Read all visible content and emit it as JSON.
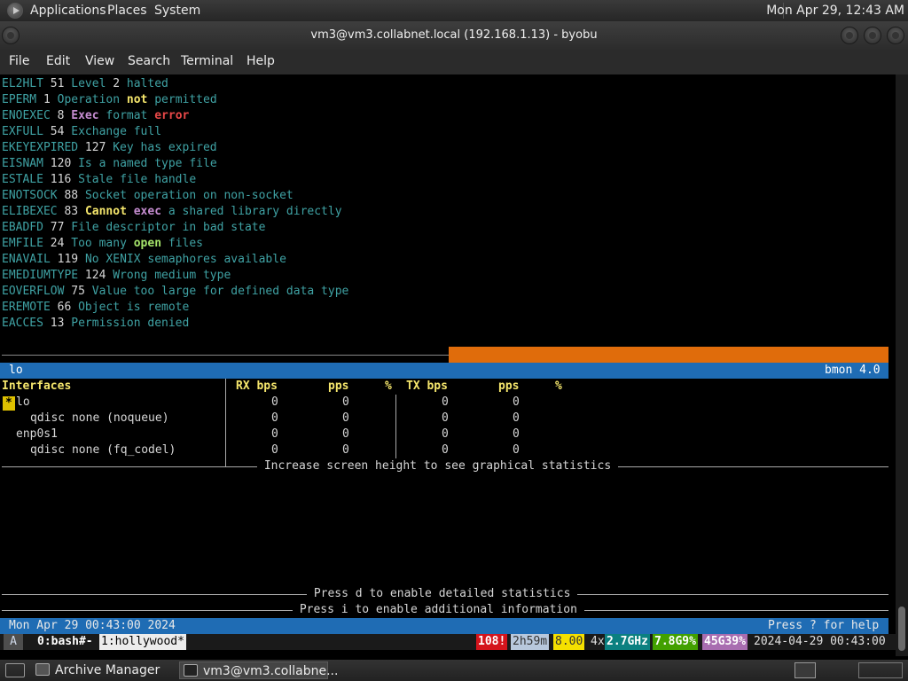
{
  "top_panel": {
    "applications": "Applications",
    "places": "Places",
    "system": "System",
    "clock": "Mon Apr 29, 12:43 AM"
  },
  "window": {
    "title": "vm3@vm3.collabnet.local (192.168.1.13) - byobu"
  },
  "menubar": [
    "File",
    "Edit",
    "View",
    "Search",
    "Terminal",
    "Help"
  ],
  "errors": [
    {
      "name": "EL2HLT",
      "num": "51",
      "parts": [
        [
          "Level ",
          "d"
        ],
        [
          "2",
          "n"
        ],
        [
          " halted",
          "d"
        ]
      ]
    },
    {
      "name": "EPERM",
      "num": "1",
      "parts": [
        [
          "Operation ",
          "d"
        ],
        [
          "not",
          "y"
        ],
        [
          " permitted",
          "d"
        ]
      ]
    },
    {
      "name": "ENOEXEC",
      "num": "8",
      "parts": [
        [
          "Exec",
          "p"
        ],
        [
          " format ",
          "d"
        ],
        [
          "error",
          "r"
        ]
      ]
    },
    {
      "name": "EXFULL",
      "num": "54",
      "parts": [
        [
          "Exchange full",
          "d"
        ]
      ]
    },
    {
      "name": "EKEYEXPIRED",
      "num": "127",
      "parts": [
        [
          "Key has expired",
          "d"
        ]
      ]
    },
    {
      "name": "EISNAM",
      "num": "120",
      "parts": [
        [
          "Is a named type file",
          "d"
        ]
      ]
    },
    {
      "name": "ESTALE",
      "num": "116",
      "parts": [
        [
          "Stale file handle",
          "d"
        ]
      ]
    },
    {
      "name": "ENOTSOCK",
      "num": "88",
      "parts": [
        [
          "Socket operation on non-socket",
          "d"
        ]
      ]
    },
    {
      "name": "ELIBEXEC",
      "num": "83",
      "parts": [
        [
          "Cannot",
          "y"
        ],
        [
          " ",
          "d"
        ],
        [
          "exec",
          "p"
        ],
        [
          " a shared library directly",
          "d"
        ]
      ]
    },
    {
      "name": "EBADFD",
      "num": "77",
      "parts": [
        [
          "File descriptor in bad state",
          "d"
        ]
      ]
    },
    {
      "name": "EMFILE",
      "num": "24",
      "parts": [
        [
          "Too many ",
          "d"
        ],
        [
          "open",
          "g"
        ],
        [
          " files",
          "d"
        ]
      ]
    },
    {
      "name": "ENAVAIL",
      "num": "119",
      "parts": [
        [
          "No XENIX semaphores available",
          "d"
        ]
      ]
    },
    {
      "name": "EMEDIUMTYPE",
      "num": "124",
      "parts": [
        [
          "Wrong medium type",
          "d"
        ]
      ]
    },
    {
      "name": "EOVERFLOW",
      "num": "75",
      "parts": [
        [
          "Value too large for defined data type",
          "d"
        ]
      ]
    },
    {
      "name": "EREMOTE",
      "num": "66",
      "parts": [
        [
          "Object is remote",
          "d"
        ]
      ]
    },
    {
      "name": "EACCES",
      "num": "13",
      "parts": [
        [
          "Permission denied",
          "d"
        ]
      ]
    }
  ],
  "bmon": {
    "iface_name": "lo",
    "version": "bmon 4.0",
    "headers": {
      "interfaces": "Interfaces",
      "rx_bps": "RX bps",
      "rx_pps": "pps",
      "rx_pct": "%",
      "tx_bps": "TX bps",
      "tx_pps": "pps",
      "tx_pct": "%"
    },
    "rows": [
      {
        "label": "lo",
        "rx_bps": "0",
        "rx_pps": "0",
        "tx_bps": "0",
        "tx_pps": "0"
      },
      {
        "label": "qdisc none (noqueue)",
        "rx_bps": "0",
        "rx_pps": "0",
        "tx_bps": "0",
        "tx_pps": "0"
      },
      {
        "label": "enp0s1",
        "rx_bps": "0",
        "rx_pps": "0",
        "tx_bps": "0",
        "tx_pps": "0"
      },
      {
        "label": "qdisc none (fq_codel)",
        "rx_bps": "0",
        "rx_pps": "0",
        "tx_bps": "0",
        "tx_pps": "0"
      }
    ],
    "graph_msg": " Increase screen height to see graphical statistics ",
    "detail_msg": " Press d to enable detailed statistics ",
    "info_msg": " Press i to enable additional information ",
    "timestamp": "Mon Apr 29 00:43:00 2024",
    "help": "Press ? for help"
  },
  "byobu": {
    "session_letter": "A",
    "win0": "0:bash#-",
    "win1": "1:hollywood*",
    "updates": "108!",
    "uptime": "2h59m",
    "load": "8.00",
    "cpu_count": "4x",
    "cpu_freq": "2.7GHz",
    "mem": "7.8G9%",
    "disk": "45G39%",
    "datetime": "2024-04-29 00:43:00"
  },
  "taskbar": {
    "task1": "Archive Manager",
    "task2": "vm3@vm3.collabne..."
  },
  "colors": {
    "cyan": "#3fa2a4",
    "yellow": "#f5e66c",
    "orange": "#e06c0b",
    "blue": "#1f6cb4",
    "red": "#e94848",
    "purple": "#c58cd0",
    "green": "#a5e36a"
  }
}
